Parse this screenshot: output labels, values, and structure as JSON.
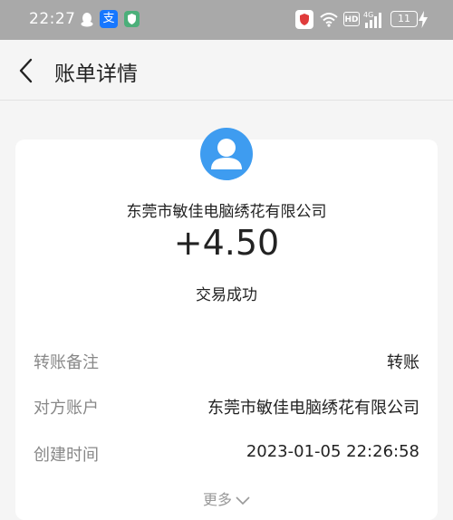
{
  "status_bar": {
    "time": "22:27",
    "battery": "11",
    "hd": "HD",
    "network": "4G",
    "icons": [
      "qq-icon",
      "alipay-icon",
      "shield-app-icon",
      "security-icon",
      "wifi-icon",
      "hd-icon",
      "signal-icon",
      "battery-icon",
      "charging-bolt-icon"
    ],
    "alipay_glyph": "支",
    "bar_color": "#a9a9a9"
  },
  "nav": {
    "title": "账单详情",
    "back_icon": "chevron-left-icon"
  },
  "bill": {
    "counterparty": "东莞市敏佳电脑绣花有限公司",
    "amount": "+4.50",
    "status": "交易成功",
    "avatar_icon": "user-avatar-icon",
    "avatar_color": "#3e9cf0"
  },
  "details": [
    {
      "label": "转账备注",
      "value": "转账"
    },
    {
      "label": "对方账户",
      "value": "东莞市敏佳电脑绣花有限公司"
    },
    {
      "label": "创建时间",
      "value": "2023-01-05 22:26:58"
    }
  ],
  "more": {
    "label": "更多",
    "icon": "chevron-down-icon"
  }
}
